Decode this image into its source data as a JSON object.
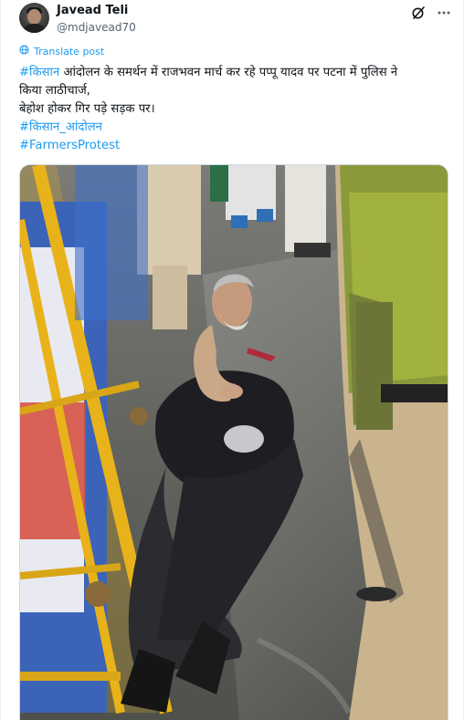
{
  "author": {
    "display_name": "Javead Teli",
    "handle": "@mdjavead70"
  },
  "icons": {
    "avatar": "avatar-photo",
    "grok": "grok-icon",
    "more": "more-options-icon",
    "translate": "globe-icon"
  },
  "translate": {
    "label": "Translate post"
  },
  "tweet": {
    "hashtag_1": "#किसान",
    "line_1_text": " आंदोलन के समर्थन में राजभवन मार्च कर रहे पप्पू यादव पर पटना में पुलिस ने",
    "line_2": "किया लाठीचार्ज,",
    "line_3": "बेहोश होकर गिर पड़े सड़क पर।",
    "hashtag_2": "#किसान_आंदोलन",
    "hashtag_3": "#FarmersProtest"
  },
  "colors": {
    "link": "#1d9bf0",
    "text": "#0f1419",
    "secondary": "#536471"
  }
}
